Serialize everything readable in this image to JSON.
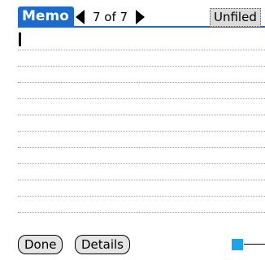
{
  "app": {
    "title": "Memo"
  },
  "navigation": {
    "record_count": "7 of 7"
  },
  "category": {
    "selected": "Unfiled"
  },
  "memo": {
    "body_text": ""
  },
  "buttons": {
    "done_label": "Done",
    "details_label": "Details"
  },
  "colors": {
    "title_tab": "#1a6cd0",
    "scroll_indicator": "#19a6ea",
    "button_fill": "#e4e4e4",
    "category_fill": "#dcdcdc"
  },
  "icons": {
    "previous": "arrow-left-icon",
    "next": "arrow-right-icon"
  }
}
